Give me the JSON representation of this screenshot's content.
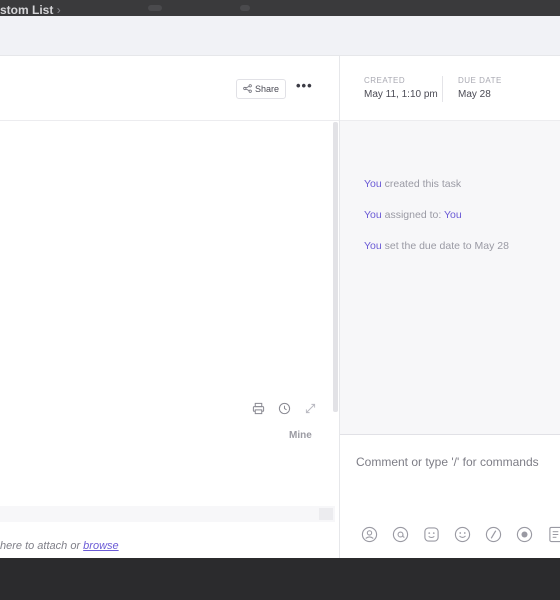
{
  "window": {
    "breadcrumb_title": "stom List",
    "breadcrumb_caret": "›"
  },
  "header": {
    "share_label": "Share",
    "more_label": "•••"
  },
  "meta": {
    "created_label": "CREATED",
    "created_value": "May 11, 1:10 pm",
    "due_label": "DUE DATE",
    "due_value": "May 28"
  },
  "activity": [
    {
      "actor": "You",
      "text": " created this task",
      "target": ""
    },
    {
      "actor": "You",
      "text": " assigned to: ",
      "target": "You"
    },
    {
      "actor": "You",
      "text": " set the due date to May 28",
      "target": ""
    }
  ],
  "filter": {
    "mine_label": "Mine"
  },
  "attach": {
    "text": "here to attach or ",
    "link": "browse"
  },
  "comment": {
    "placeholder": "Comment or type '/' for commands"
  },
  "icons": {
    "doc_tools": [
      "print-icon",
      "history-icon",
      "expand-icon"
    ],
    "comment_tools": [
      "assign-comment-icon",
      "mention-icon",
      "reaction-icon",
      "emoji-icon",
      "slash-command-icon",
      "record-icon",
      "attach-doc-icon"
    ]
  },
  "colors": {
    "accent": "#6b5bd6",
    "muted_text": "#9a9aa4",
    "panel_bg": "#f7f7f9"
  }
}
